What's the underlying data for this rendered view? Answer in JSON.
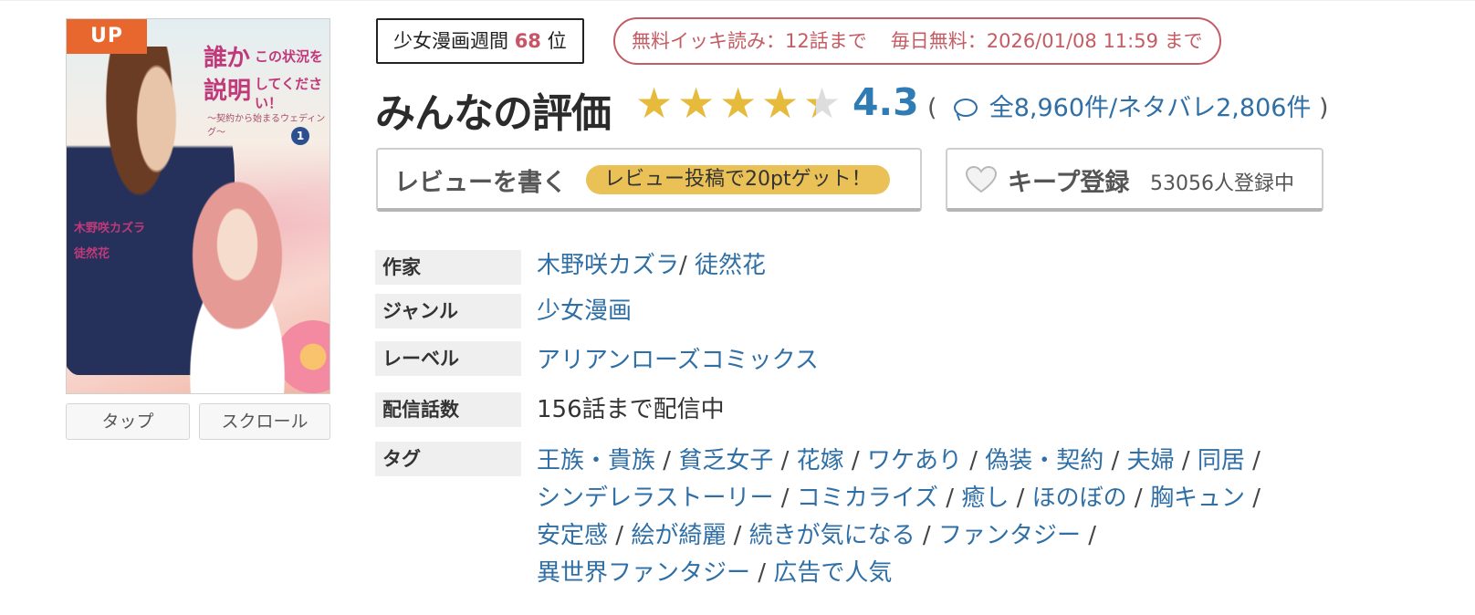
{
  "cover": {
    "badge": "UP",
    "title_line1": "誰か",
    "title_line1_small": "この状況を",
    "title_line2": "説明",
    "title_line2_small": "してください！",
    "subtitle": "～契約から始まるウェディング～",
    "volume": "1",
    "author_text": "木野咲カズラ",
    "artist_text": "徒然花",
    "tap_button": "タップ",
    "scroll_button": "スクロール"
  },
  "ranking": {
    "prefix": "少女漫画週間",
    "rank": "68",
    "suffix": "位"
  },
  "free_info": {
    "ikki": "無料イッキ読み：12話まで",
    "daily": "毎日無料：2026/01/08 11:59 まで"
  },
  "rating": {
    "label": "みんなの評価",
    "value": "4.3",
    "stars_fraction": 0.86,
    "open_paren": "(",
    "counts": "全8,960件/ネタバレ2,806件",
    "close_paren": ")",
    "star_color": "#e6bb3c",
    "value_color": "#2f7bb3"
  },
  "actions": {
    "review_label": "レビューを書く",
    "review_bonus": "レビュー投稿で20ptゲット！",
    "keep_label": "キープ登録",
    "keep_count": "53056人登録中"
  },
  "meta": {
    "author_label": "作家",
    "authors": [
      "木野咲カズラ",
      "徒然花"
    ],
    "genre_label": "ジャンル",
    "genre": "少女漫画",
    "label_label": "レーベル",
    "label": "アリアンローズコミックス",
    "episodes_label": "配信話数",
    "episodes": "156話まで配信中",
    "tags_label": "タグ",
    "tags": [
      "王族・貴族",
      "貧乏女子",
      "花嫁",
      "ワケあり",
      "偽装・契約",
      "夫婦",
      "同居",
      "シンデレラストーリー",
      "コミカライズ",
      "癒し",
      "ほのぼの",
      "胸キュン",
      "安定感",
      "絵が綺麗",
      "続きが気になる",
      "ファンタジー",
      "異世界ファンタジー",
      "広告で人気"
    ]
  },
  "colors": {
    "link": "#2f6fa5",
    "free_border": "#c55b63",
    "up_badge": "#e8672f",
    "bonus_pill": "#e9c156"
  }
}
